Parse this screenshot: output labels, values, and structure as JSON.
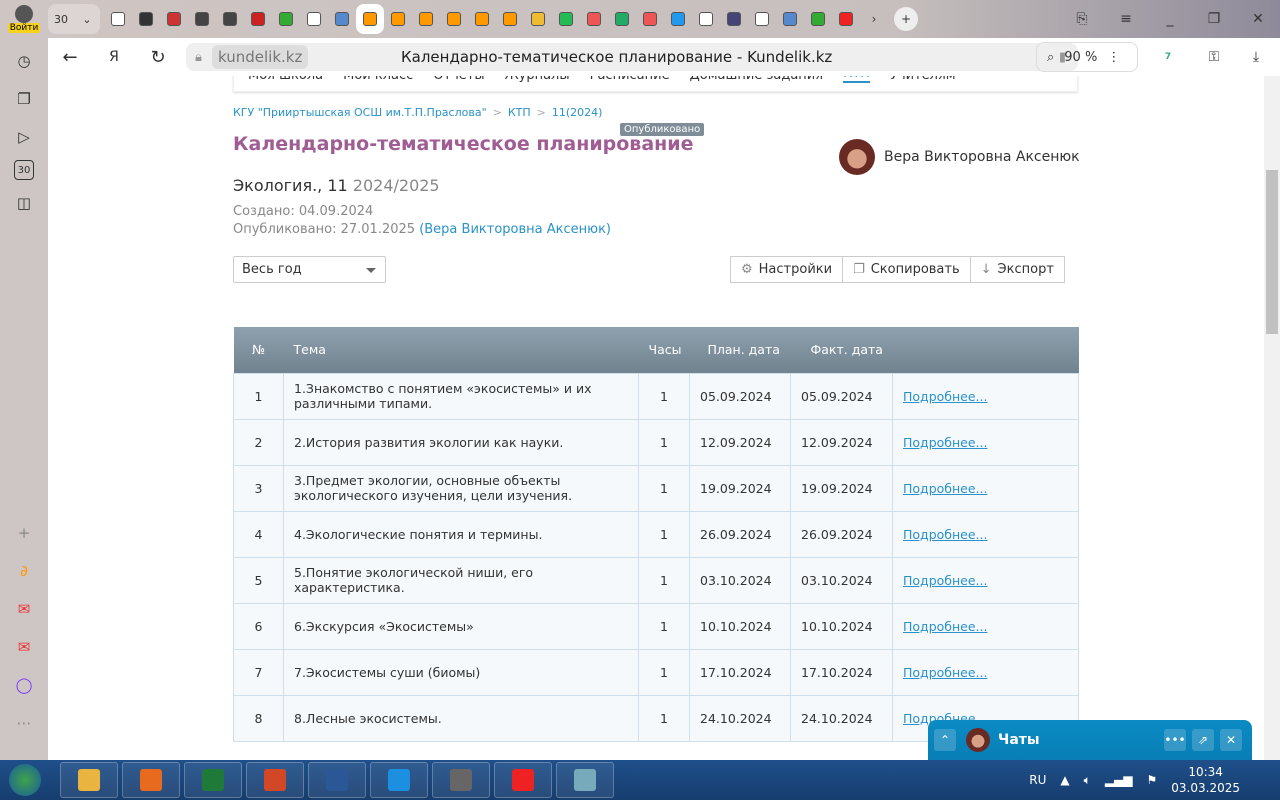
{
  "browser": {
    "login_label": "Войти",
    "tab_group_count": "30",
    "tab_colors": [
      "#fff",
      "#333",
      "#c33",
      "#444",
      "#444",
      "#c22",
      "#3a3",
      "#fff",
      "#58c",
      "#f90",
      "#f90",
      "#f90",
      "#f90",
      "#f90",
      "#f90",
      "#eb3",
      "#2b5",
      "#e55",
      "#2a6",
      "#e55",
      "#29e",
      "#fff",
      "#447",
      "#fff",
      "#58c",
      "#3a3",
      "#e22"
    ],
    "active_tab_index": 9,
    "url_domain": "kundelik.kz",
    "page_title": "Календарно-тематическое планирование - Kundelik.kz",
    "zoom": "90 %",
    "protect_badge": "7",
    "side_badge": "30"
  },
  "nav": {
    "items": [
      "Моя школа",
      "Мой класс",
      "Отчеты",
      "Журналы",
      "Расписание",
      "Домашние задания",
      "КТП",
      "Учителям"
    ],
    "active": "КТП"
  },
  "breadcrumb": [
    "КГУ \"Прииртышская ОСШ им.Т.П.Праслова\"",
    "КТП",
    "11(2024)"
  ],
  "header": {
    "title": "Календарно-тематическое планирование",
    "status": "Опубликовано",
    "author": "Вера Викторовна Аксенюк"
  },
  "subject": {
    "name": "Экология., 11",
    "year": "2024/2025"
  },
  "meta": {
    "created": "Создано: 04.09.2024",
    "published": "Опубликовано: 27.01.2025",
    "published_by": "(Вера Викторовна Аксенюк)"
  },
  "filter": {
    "selected": "Весь год"
  },
  "toolbar": {
    "settings": "Настройки",
    "copy": "Скопировать",
    "export": "Экспорт"
  },
  "table": {
    "headers": [
      "№",
      "Тема",
      "Часы",
      "План. дата",
      "Факт. дата"
    ],
    "link_label": "Подробнее...",
    "rows": [
      [
        "1",
        "1.Знакомство с понятием «экосистемы» и их различными типами.",
        "1",
        "05.09.2024",
        "05.09.2024"
      ],
      [
        "2",
        "2.История развития экологии как науки.",
        "1",
        "12.09.2024",
        "12.09.2024"
      ],
      [
        "3",
        "3.Предмет экологии, основные объекты экологического изучения, цели изучения.",
        "1",
        "19.09.2024",
        "19.09.2024"
      ],
      [
        "4",
        "4.Экологические понятия и термины.",
        "1",
        "26.09.2024",
        "26.09.2024"
      ],
      [
        "5",
        "5.Понятие экологической ниши, его характеристика.",
        "1",
        "03.10.2024",
        "03.10.2024"
      ],
      [
        "6",
        "6.Экскурсия «Экосистемы»",
        "1",
        "10.10.2024",
        "10.10.2024"
      ],
      [
        "7",
        "7.Экосистемы суши (биомы)",
        "1",
        "17.10.2024",
        "17.10.2024"
      ],
      [
        "8",
        "8.Лесные экосистемы.",
        "1",
        "24.10.2024",
        "24.10.2024"
      ]
    ]
  },
  "chat": {
    "title": "Чаты"
  },
  "taskbar": {
    "lang": "RU",
    "time": "10:34",
    "date": "03.03.2025",
    "app_colors": [
      "#e9b540",
      "#e86a1f",
      "#1f7a3a",
      "#d24726",
      "#2b5797",
      "#1c8fe0",
      "#666",
      "#e22",
      "#7ab"
    ]
  }
}
